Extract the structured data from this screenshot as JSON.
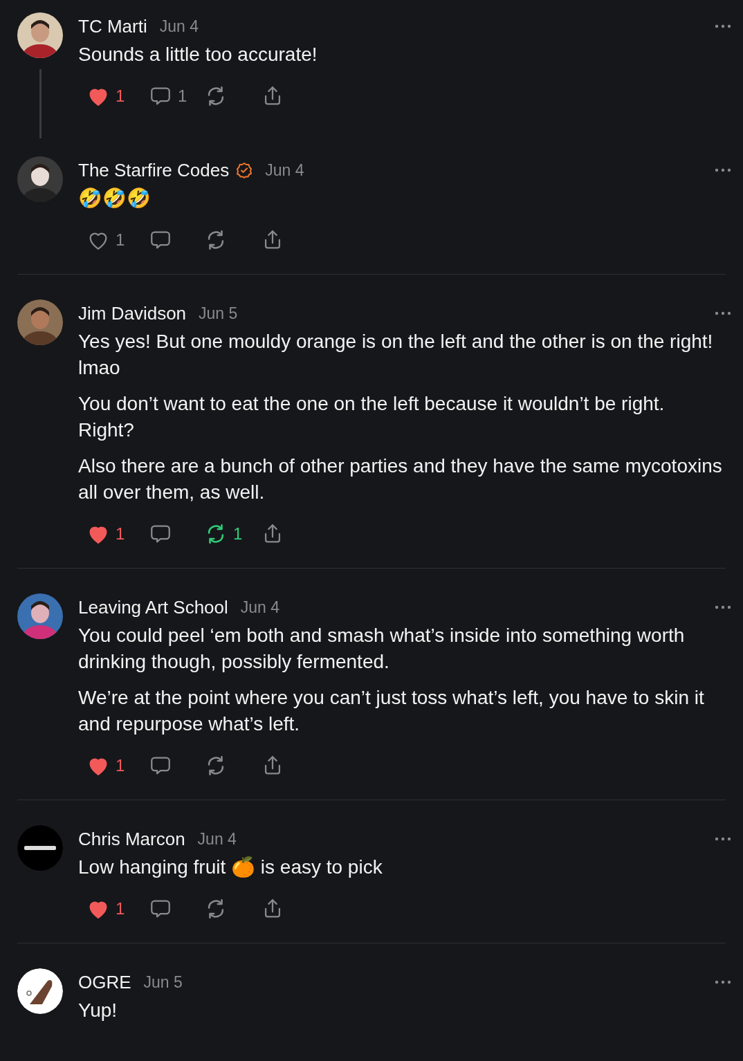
{
  "comments": [
    {
      "avatar": {
        "kind": "picture"
      },
      "name": "TC Marti",
      "verified": false,
      "date": "Jun 4",
      "paragraphs": [
        "Sounds a little too accurate!"
      ],
      "thread_line": true,
      "divider": false,
      "actions": {
        "liked": true,
        "likes": "1",
        "replies": "1",
        "restacked": false
      }
    },
    {
      "avatar": {
        "kind": "picture"
      },
      "name": "The Starfire Codes",
      "verified": true,
      "date": "Jun 4",
      "paragraphs": [
        "🤣🤣🤣"
      ],
      "thread_line": false,
      "divider": true,
      "actions": {
        "liked": false,
        "likes": "1",
        "restacked": false
      }
    },
    {
      "avatar": {
        "kind": "picture"
      },
      "name": "Jim Davidson",
      "verified": false,
      "date": "Jun 5",
      "paragraphs": [
        "Yes yes! But one mouldy orange is on the left and the other is on the right! lmao",
        "You don’t want to eat the one on the left because it wouldn’t be right. Right?",
        "Also there are a bunch of other parties and they have the same mycotoxins all over them, as well."
      ],
      "thread_line": false,
      "divider": true,
      "actions": {
        "liked": true,
        "likes": "1",
        "restacked": true,
        "restacks": "1"
      }
    },
    {
      "avatar": {
        "kind": "picture"
      },
      "name": "Leaving Art School",
      "verified": false,
      "date": "Jun 4",
      "paragraphs": [
        "You could peel ‘em both and smash what’s inside into something worth drinking though, possibly fermented.",
        "We’re at the point where you can’t just toss what’s left, you have to skin it and repurpose what’s left."
      ],
      "thread_line": false,
      "divider": true,
      "actions": {
        "liked": true,
        "likes": "1",
        "restacked": false
      }
    },
    {
      "avatar": {
        "kind": "picture"
      },
      "name": "Chris Marcon",
      "verified": false,
      "date": "Jun 4",
      "paragraphs": [
        "Low hanging fruit 🍊 is easy to pick"
      ],
      "thread_line": false,
      "divider": true,
      "actions": {
        "liked": true,
        "likes": "1",
        "restacked": false
      }
    },
    {
      "avatar": {
        "kind": "picture"
      },
      "name": "OGRE",
      "verified": false,
      "date": "Jun 5",
      "paragraphs": [
        "Yup!"
      ]
    }
  ]
}
